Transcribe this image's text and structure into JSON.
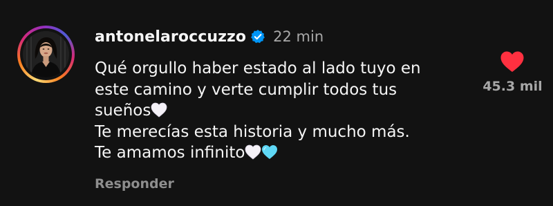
{
  "comment": {
    "username": "antonelaroccuzzo",
    "verified": true,
    "timestamp": "22 min",
    "text_lines": [
      {
        "text": "Qué orgullo haber estado al lado tuyo en",
        "emojis": []
      },
      {
        "text": "este camino y verte cumplir todos tus",
        "emojis": []
      },
      {
        "text": "sueños",
        "emojis": [
          "white-heart"
        ]
      },
      {
        "text": "Te merecías esta historia y mucho más.",
        "emojis": []
      },
      {
        "text": "Te amamos infinito",
        "emojis": [
          "white-heart",
          "light-blue-heart"
        ]
      }
    ],
    "reply_label": "Responder",
    "likes": {
      "count": "45.3 mil",
      "liked": true,
      "icon": "heart-filled-icon"
    }
  },
  "colors": {
    "background": "#121212",
    "primary_text": "#f5f5f5",
    "secondary_text": "#a8a8a8",
    "reply_text": "#8e8e8e",
    "like_red": "#ff3040",
    "verified_blue": "#0095f6",
    "white_heart": "#f4f1f7",
    "light_blue_heart": "#5ed7f5"
  }
}
